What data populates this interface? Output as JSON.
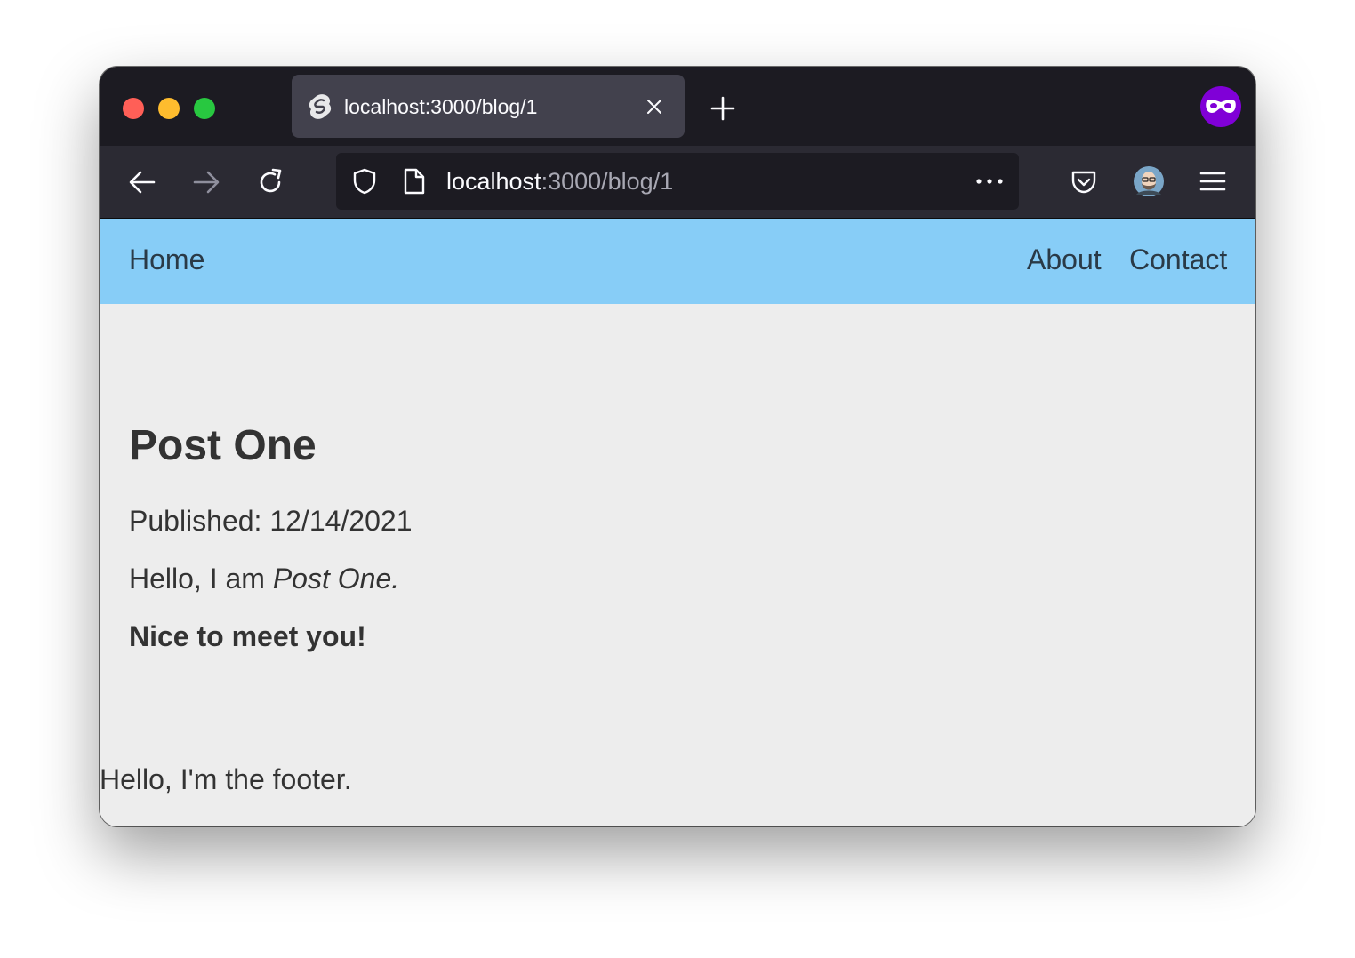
{
  "browser": {
    "tab": {
      "title": "localhost:3000/blog/1"
    },
    "urlbar": {
      "host": "localhost",
      "rest": ":3000/blog/1"
    }
  },
  "site": {
    "nav": {
      "home": "Home",
      "about": "About",
      "contact": "Contact"
    },
    "post": {
      "title": "Post One",
      "published": "Published: 12/14/2021",
      "intro_text": "Hello, I am ",
      "intro_emphasis": "Post One.",
      "greeting": "Nice to meet you!"
    },
    "footer": "Hello, I'm the footer."
  },
  "colors": {
    "header_bg": "#87cdf7",
    "page_bg": "#ededed",
    "chrome_dark": "#1c1b22",
    "toolbar": "#2b2a33",
    "tab_active": "#42414d",
    "private_purple": "#8000d7"
  },
  "icons": {
    "tab_favicon": "svelte-logo-icon",
    "close": "close-icon",
    "new_tab": "plus-icon",
    "private": "private-browsing-mask-icon",
    "back": "arrow-left-icon",
    "forward": "arrow-right-icon",
    "reload": "reload-icon",
    "shield": "shield-icon",
    "page": "page-icon",
    "more": "more-dots-icon",
    "pocket": "pocket-icon",
    "account": "avatar-icon",
    "menu": "hamburger-menu-icon"
  }
}
